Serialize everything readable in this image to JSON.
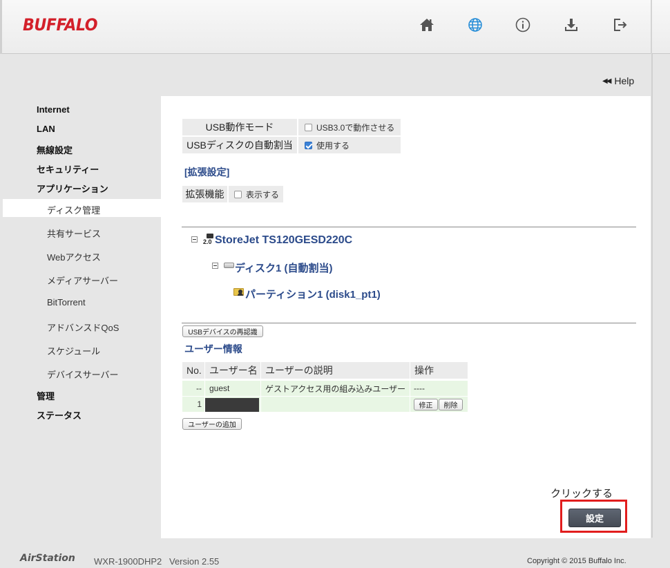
{
  "header": {
    "logo": "BUFFALO",
    "icons": [
      "home-icon",
      "globe-icon",
      "info-icon",
      "download-icon",
      "logout-icon"
    ],
    "accent_color": "#d3202a"
  },
  "help": {
    "label": "Help"
  },
  "sidebar": {
    "items": [
      {
        "label": "Internet"
      },
      {
        "label": "LAN"
      },
      {
        "label": "無線設定"
      },
      {
        "label": "セキュリティー"
      },
      {
        "label": "アプリケーション"
      },
      {
        "label": "ディスク管理"
      },
      {
        "label": "共有サービス"
      },
      {
        "label": "Webアクセス"
      },
      {
        "label": "メディアサーバー"
      },
      {
        "label": "BitTorrent"
      },
      {
        "label": "アドバンスドQoS"
      },
      {
        "label": "スケジュール"
      },
      {
        "label": "デバイスサーバー"
      },
      {
        "label": "管理"
      },
      {
        "label": "ステータス"
      }
    ],
    "active": "ディスク管理"
  },
  "settings": {
    "usb_mode_label": "USB動作モード",
    "usb_mode_option": "USB3.0で動作させる",
    "usb_mode_checked": false,
    "auto_assign_label": "USBディスクの自動割当",
    "auto_assign_option": "使用する",
    "auto_assign_checked": true,
    "advanced_title": "[拡張設定]",
    "ext_label": "拡張機能",
    "ext_option": "表示する",
    "ext_checked": false
  },
  "tree": {
    "usb_badge": "2.0",
    "device": "StoreJet TS120GESD220C",
    "disk": "ディスク1 (自動割当)",
    "partition": "パーティション1 (disk1_pt1)"
  },
  "rescan_button": "USBデバイスの再認識",
  "users": {
    "title": "ユーザー情報",
    "headers": [
      "No.",
      "ユーザー名",
      "ユーザーの説明",
      "操作"
    ],
    "rows": [
      {
        "no": "--",
        "name": "guest",
        "desc": "ゲストアクセス用の組み込みユーザー",
        "ops": "----"
      },
      {
        "no": "1",
        "name": "",
        "desc": "",
        "edit": "修正",
        "delete": "削除"
      }
    ],
    "add_button": "ユーザーの追加"
  },
  "annotation": "クリックする",
  "apply_button": "設定",
  "footer": {
    "brand": "AirStation",
    "model": "WXR-1900DHP2",
    "version": "Version 2.55",
    "copyright": "Copyright © 2015 Buffalo Inc."
  }
}
